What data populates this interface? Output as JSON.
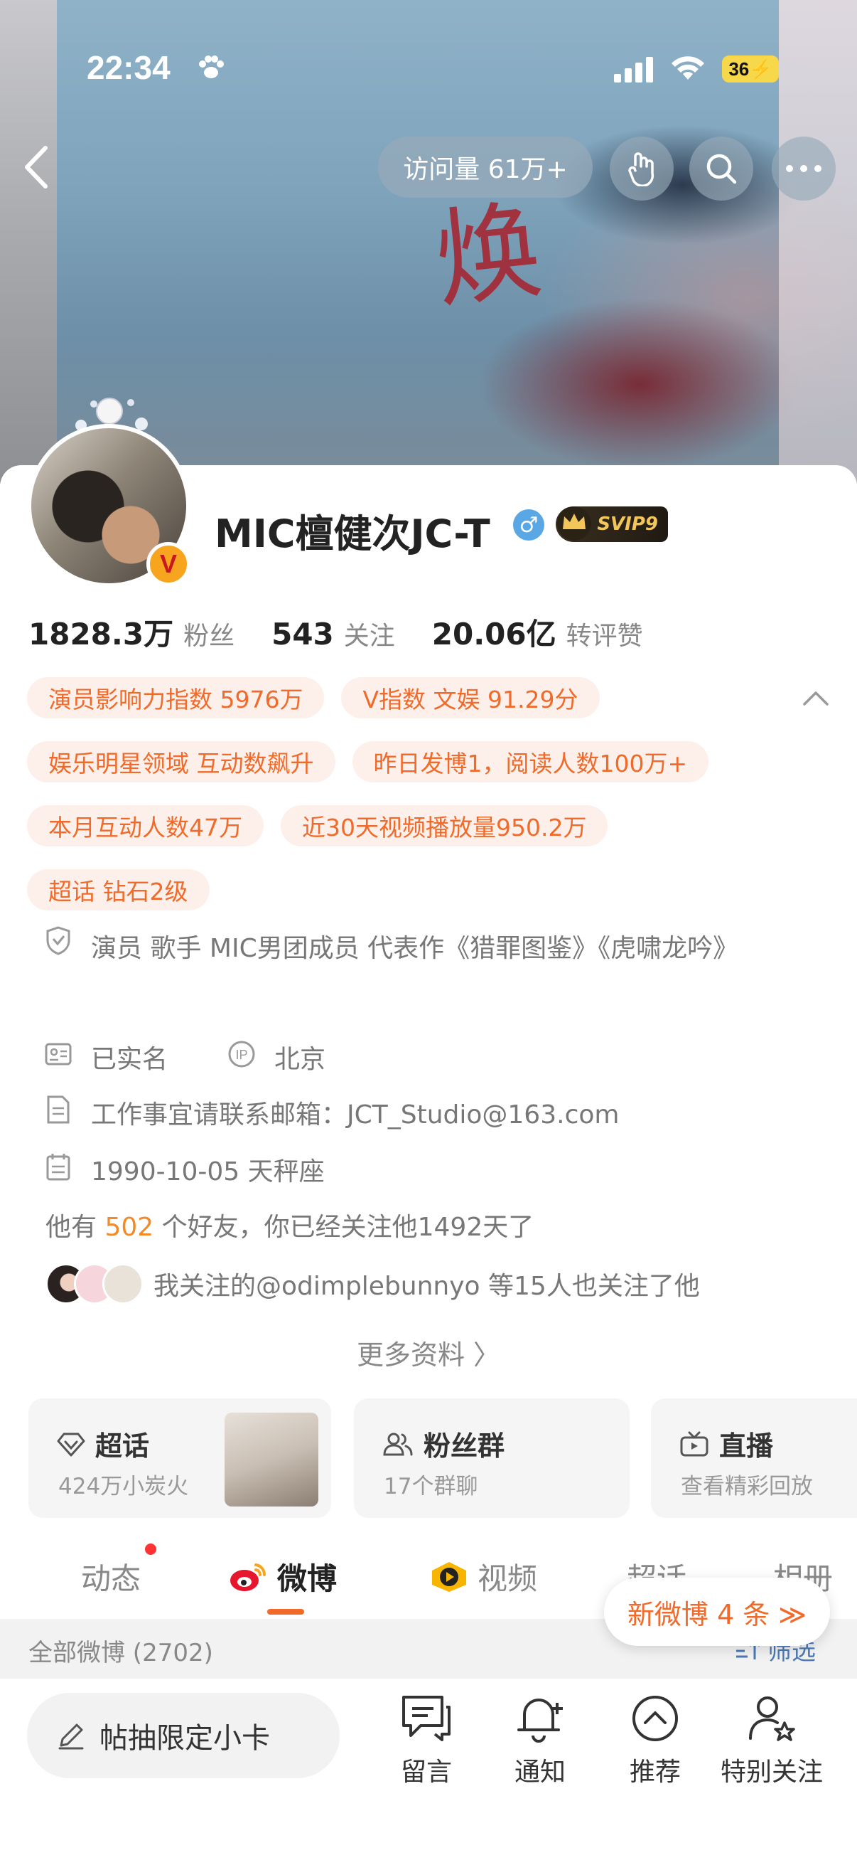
{
  "status_bar": {
    "time": "22:34",
    "battery": "36"
  },
  "header": {
    "visits_label": "访问量 61万+"
  },
  "profile": {
    "username": "MIC檀健次JC-T",
    "gender_symbol": "♂",
    "svip_label": "SVIP9",
    "verified_badge": "V",
    "stats": [
      {
        "value": "1828.3万",
        "label": "粉丝"
      },
      {
        "value": "543",
        "label": "关注"
      },
      {
        "value": "20.06亿",
        "label": "转评赞"
      }
    ],
    "tags": [
      [
        "演员影响力指数 5976万",
        "V指数 文娱 91.29分"
      ],
      [
        "娱乐明星领域 互动数飙升",
        "昨日发博1，阅读人数100万+"
      ],
      [
        "本月互动人数47万",
        "近30天视频播放量950.2万"
      ],
      [
        "超话 钻石2级"
      ]
    ],
    "bio": "演员 歌手 MIC男团成员 代表作《猎罪图鉴》《虎啸龙吟》",
    "real_name": "已实名",
    "ip_location": "北京",
    "email": "工作事宜请联系邮箱：JCT_Studio@163.com",
    "birthday": "1990-10-05 天秤座",
    "friends_prefix": "他有 ",
    "friends_count": "502",
    "friends_suffix": " 个好友，你已经关注他1492天了",
    "mutual_follow": "我关注的@odimplebunnyo 等15人也关注了他",
    "more_info": "更多资料 〉"
  },
  "feature_cards": [
    {
      "title": "超话",
      "subtitle": "424万小炭火"
    },
    {
      "title": "粉丝群",
      "subtitle": "17个群聊"
    },
    {
      "title": "直播",
      "subtitle": "查看精彩回放"
    }
  ],
  "tabs": [
    "动态",
    "微博",
    "视频",
    "超话",
    "相册"
  ],
  "new_weibo": "新微博 4 条 ≫",
  "feed": {
    "count_label": "全部微博 (2702)",
    "filter_label": "筛选"
  },
  "bottom_bar": {
    "compose_placeholder": "帖抽限定小卡",
    "items": [
      "留言",
      "通知",
      "推荐",
      "特别关注"
    ]
  },
  "colors": {
    "accent": "#f26a2a",
    "tag_bg": "#fdf0ea",
    "link": "#4a79b7"
  }
}
